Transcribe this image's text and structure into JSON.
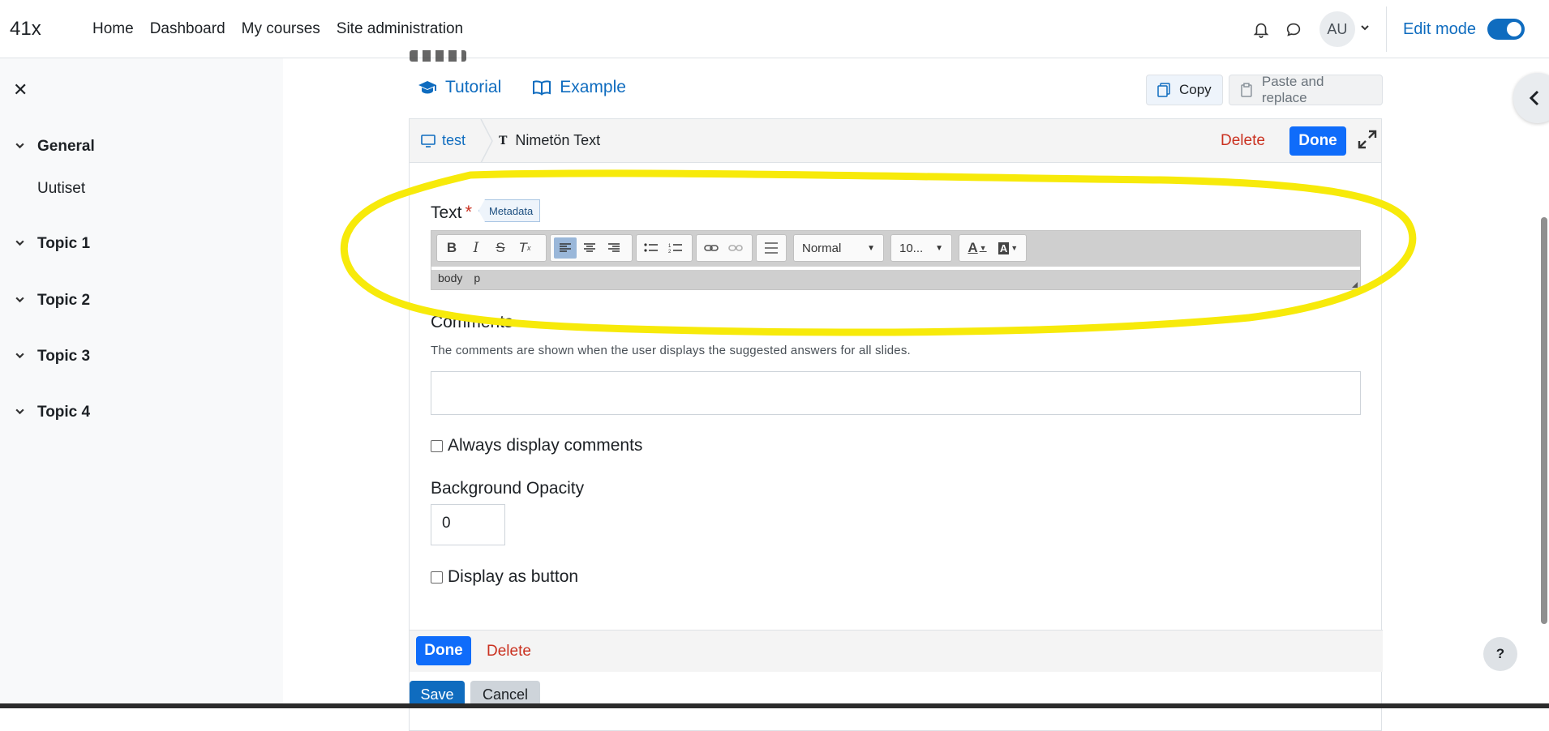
{
  "navbar": {
    "brand": "41x",
    "links": [
      "Home",
      "Dashboard",
      "My courses",
      "Site administration"
    ],
    "avatar_initials": "AU",
    "edit_mode_label": "Edit mode",
    "edit_mode_on": true,
    "icons": [
      "bell-icon",
      "chat-icon",
      "chevron-down-icon"
    ]
  },
  "drawer": {
    "sections": [
      {
        "label": "General",
        "items": [
          "Uutiset"
        ]
      },
      {
        "label": "Topic 1",
        "items": []
      },
      {
        "label": "Topic 2",
        "items": []
      },
      {
        "label": "Topic 3",
        "items": []
      },
      {
        "label": "Topic 4",
        "items": []
      }
    ]
  },
  "main": {
    "tabs": [
      "Tutorial",
      "Example"
    ],
    "copy_label": "Copy",
    "paste_label": "Paste and replace",
    "breadcrumb": {
      "root": "test",
      "current": "Nimetön Text"
    },
    "delete_label": "Delete",
    "done_label": "Done",
    "text_field": {
      "label": "Text",
      "required_mark": "*",
      "metadata_label": "Metadata"
    },
    "editor": {
      "format_value": "Normal",
      "size_value": "10...",
      "path": [
        "body",
        "p"
      ]
    },
    "comments": {
      "label": "Comments",
      "help": "The comments are shown when the user displays the suggested answers for all slides.",
      "value": ""
    },
    "always_display_label": "Always display comments",
    "opacity": {
      "label": "Background Opacity",
      "value": "0"
    },
    "display_button_label": "Display as button",
    "footer": {
      "done": "Done",
      "delete": "Delete"
    },
    "save_label": "Save",
    "cancel_label": "Cancel"
  },
  "help_button": "?",
  "colors": {
    "accent": "#0f6cbf",
    "done": "#0f6cfa",
    "delete": "#ca3120",
    "highlight": "#f7ea0a"
  }
}
